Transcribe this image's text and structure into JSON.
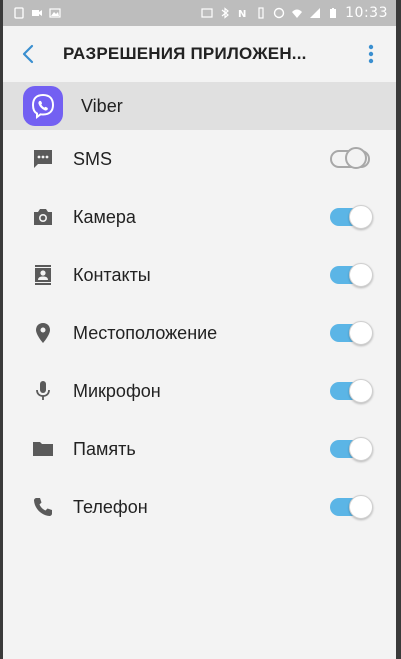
{
  "status_bar": {
    "time": "10:33"
  },
  "header": {
    "title": "РАЗРЕШЕНИЯ ПРИЛОЖЕН...",
    "back_icon": "chevron-left-icon",
    "menu_icon": "more-vert-icon"
  },
  "app": {
    "name": "Viber",
    "icon": "viber-logo",
    "icon_color": "#7360f2"
  },
  "colors": {
    "accent": "#5bb5e6",
    "icon_gray": "#5a5a5a",
    "header_accent": "#3a8fd0"
  },
  "permissions": [
    {
      "label": "SMS",
      "icon": "sms-icon",
      "enabled": false
    },
    {
      "label": "Камера",
      "icon": "camera-icon",
      "enabled": true
    },
    {
      "label": "Контакты",
      "icon": "contacts-icon",
      "enabled": true
    },
    {
      "label": "Местоположение",
      "icon": "location-pin-icon",
      "enabled": true
    },
    {
      "label": "Микрофон",
      "icon": "microphone-icon",
      "enabled": true
    },
    {
      "label": "Память",
      "icon": "folder-icon",
      "enabled": true
    },
    {
      "label": "Телефон",
      "icon": "phone-icon",
      "enabled": true
    }
  ]
}
